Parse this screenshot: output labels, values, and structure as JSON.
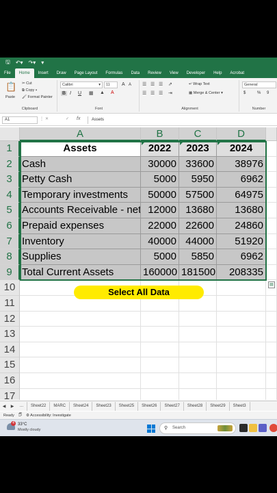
{
  "app": {
    "title_icons": [
      "save-icon",
      "undo-icon",
      "redo-icon",
      "customize-qat-icon"
    ]
  },
  "ribbon_tabs": [
    "File",
    "Home",
    "Insert",
    "Draw",
    "Page Layout",
    "Formulas",
    "Data",
    "Review",
    "View",
    "Developer",
    "Help",
    "Acrobat"
  ],
  "active_tab": "Home",
  "ribbon": {
    "clipboard": {
      "paste": "Paste",
      "cut": "Cut",
      "copy": "Copy",
      "format_painter": "Format Painter",
      "label": "Clipboard"
    },
    "font": {
      "name": "Calibri",
      "size": "11",
      "grow": "A",
      "shrink": "A",
      "bold": "B",
      "italic": "I",
      "underline": "U",
      "label": "Font"
    },
    "alignment": {
      "wrap_text": "Wrap Text",
      "merge_center": "Merge & Center",
      "label": "Alignment"
    },
    "number": {
      "format": "General",
      "currency": "$",
      "percent": "%",
      "comma": "9",
      "label": "Number"
    }
  },
  "formula_bar": {
    "name_box": "A1",
    "fx": "fx",
    "value": "Assets"
  },
  "columns": [
    "A",
    "B",
    "C",
    "D"
  ],
  "rows": [
    "1",
    "2",
    "3",
    "4",
    "5",
    "6",
    "7",
    "8",
    "9",
    "10",
    "11",
    "12",
    "13",
    "14",
    "15",
    "16",
    "17"
  ],
  "table": {
    "header": [
      "Assets",
      "2022",
      "2023",
      "2024"
    ],
    "data": [
      [
        "Cash",
        "30000",
        "33600",
        "38976"
      ],
      [
        "Petty Cash",
        "5000",
        "5950",
        "6962"
      ],
      [
        "Temporary investments",
        "50000",
        "57500",
        "64975"
      ],
      [
        "Accounts Receivable - net",
        "12000",
        "13680",
        "13680"
      ],
      [
        "Prepaid expenses",
        "22000",
        "22600",
        "24860"
      ],
      [
        "Inventory",
        "40000",
        "44000",
        "51920"
      ],
      [
        "Supplies",
        "5000",
        "5850",
        "6962"
      ],
      [
        "Total Current Assets",
        "160000",
        "181500",
        "208335"
      ]
    ]
  },
  "overlay_label": "Select All Data",
  "sheet_tabs": [
    "...",
    "Sheet22",
    "MARC",
    "Sheet24",
    "Sheet23",
    "Sheet25",
    "Sheet26",
    "Sheet27",
    "Sheet28",
    "Sheet29",
    "Sheet3"
  ],
  "status": {
    "ready": "Ready",
    "accessibility": "Accessibility: Investigate"
  },
  "taskbar": {
    "weather_badge": "4",
    "temperature": "33°C",
    "weather": "Mostly cloudy",
    "search_placeholder": "Search"
  },
  "colors": {
    "excel_green": "#217346",
    "selection_gray": "#c7c7c7",
    "highlight_yellow": "#ffeb00"
  }
}
